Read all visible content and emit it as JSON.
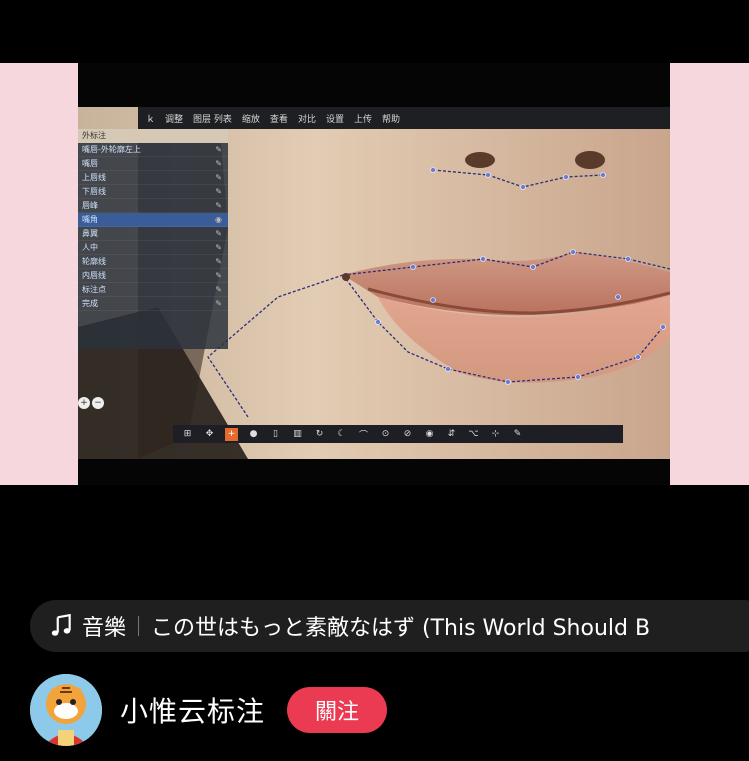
{
  "video": {
    "app_toolbar_items": [
      "ｋ",
      "调整",
      "图层 列表",
      "缩放",
      "查看",
      "对比",
      "设置",
      "上传",
      "帮助"
    ],
    "layer_panel": {
      "title": "外标注",
      "rows": [
        {
          "label": "嘴唇-外轮廓左上",
          "selected": false
        },
        {
          "label": "嘴唇",
          "selected": false
        },
        {
          "label": "上唇线",
          "selected": false
        },
        {
          "label": "下唇线",
          "selected": false
        },
        {
          "label": "唇峰",
          "selected": false
        },
        {
          "label": "嘴角",
          "selected": true
        },
        {
          "label": "鼻翼",
          "selected": false
        },
        {
          "label": "人中",
          "selected": false
        },
        {
          "label": "轮廓线",
          "selected": false
        },
        {
          "label": "内唇线",
          "selected": false
        },
        {
          "label": "标注点",
          "selected": false
        },
        {
          "label": "完成",
          "selected": false
        }
      ]
    },
    "bottom_tools": [
      "⊞",
      "✥",
      "+",
      "●",
      "▯",
      "▥",
      "↻",
      "☾",
      "⌒",
      "⊙",
      "⊘",
      "◉",
      "⇵",
      "⌥",
      "⊹",
      "✎"
    ],
    "active_tool_index": 2
  },
  "music": {
    "label": "音樂",
    "song": "この世はもっと素敵なはず (This World Should B"
  },
  "author": {
    "name": "小惟云标注",
    "follow_label": "關注"
  }
}
